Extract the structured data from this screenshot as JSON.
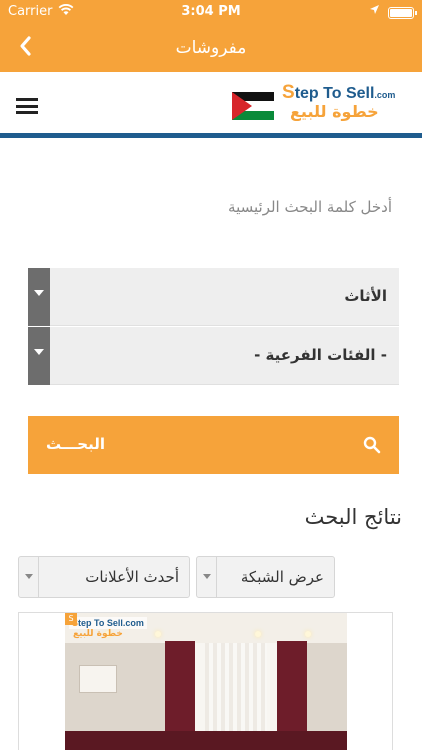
{
  "status_bar": {
    "carrier": "Carrier",
    "time": "3:04 PM"
  },
  "nav": {
    "title": "مفروشات"
  },
  "header": {
    "logo_text_en_prefix": "S",
    "logo_text_en": "tep To Sell",
    "logo_text_en_suffix": ".com",
    "logo_text_ar": "خطوة للبيع"
  },
  "search": {
    "keyword_label": "أدخل كلمة البحث الرئيسية",
    "category_value": "الأثاث",
    "subcategory_value": "- الفئات الفرعية -",
    "button_label": "البحـــث"
  },
  "results": {
    "title": "نتائج البحث",
    "view_mode": "عرض الشبكة",
    "sort_order": "أحدث الأعلانات"
  },
  "listing": {
    "watermark_en_prefix": "S",
    "watermark_en": "tep To Sell",
    "watermark_en_suffix": ".com",
    "watermark_ar": "خطوة للبيع",
    "badge": "S"
  },
  "colors": {
    "brand_orange": "#f6a33a",
    "brand_blue": "#1f5c8e"
  }
}
